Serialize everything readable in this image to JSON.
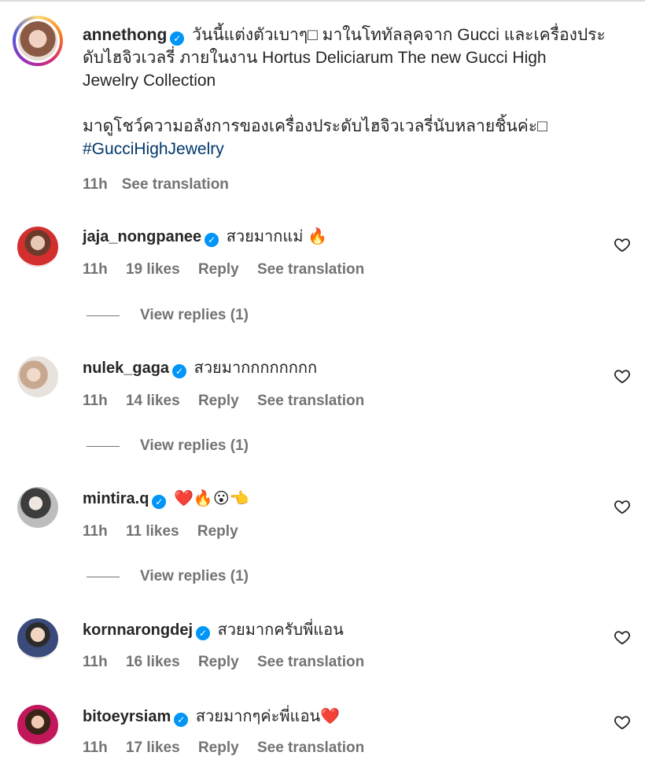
{
  "caption": {
    "username": "annethong",
    "text_line1": "วันนี้แต่งตัวเบาๆ□ มาในโททัลลุคจาก Gucci และเครื่องประ",
    "text_line2": "ดับไฮจิวเวลรี่ ภายในงาน Hortus Deliciarum The new Gucci High",
    "text_line3": "Jewelry Collection",
    "text_line4": "มาดูโชว์ความอลังการของเครื่องประดับไฮจิวเวลรี่นับหลายชิ้นค่ะ□",
    "hashtag": "#GucciHighJewelry",
    "time": "11h",
    "see_translation": "See translation"
  },
  "comments": [
    {
      "username": "jaja_nongpanee",
      "text": "สวยมากแม่",
      "emoji": "🔥",
      "time": "11h",
      "likes": "19 likes",
      "reply": "Reply",
      "see_translation": "See translation",
      "view_replies": "View replies (1)"
    },
    {
      "username": "nulek_gaga",
      "text": "สวยมากกกกกกกก",
      "emoji": "",
      "time": "11h",
      "likes": "14 likes",
      "reply": "Reply",
      "see_translation": "See translation",
      "view_replies": "View replies (1)"
    },
    {
      "username": "mintira.q",
      "text": "",
      "emoji": "❤️🔥😮👈",
      "time": "11h",
      "likes": "11 likes",
      "reply": "Reply",
      "see_translation": "",
      "view_replies": "View replies (1)"
    },
    {
      "username": "kornnarongdej",
      "text": "สวยมากครับพี่แอน",
      "emoji": "",
      "time": "11h",
      "likes": "16 likes",
      "reply": "Reply",
      "see_translation": "See translation",
      "view_replies": ""
    },
    {
      "username": "bitoeyrsiam",
      "text": "สวยมากๆค่ะพี่แอน",
      "emoji": "❤️",
      "time": "11h",
      "likes": "17 likes",
      "reply": "Reply",
      "see_translation": "See translation",
      "view_replies": ""
    }
  ],
  "colors": {
    "verified": "#0095f6",
    "hashtag": "#00376b",
    "meta": "#737373",
    "text": "#262626"
  },
  "icons": {
    "verified": "verified-badge-icon",
    "like": "heart-outline-icon"
  }
}
